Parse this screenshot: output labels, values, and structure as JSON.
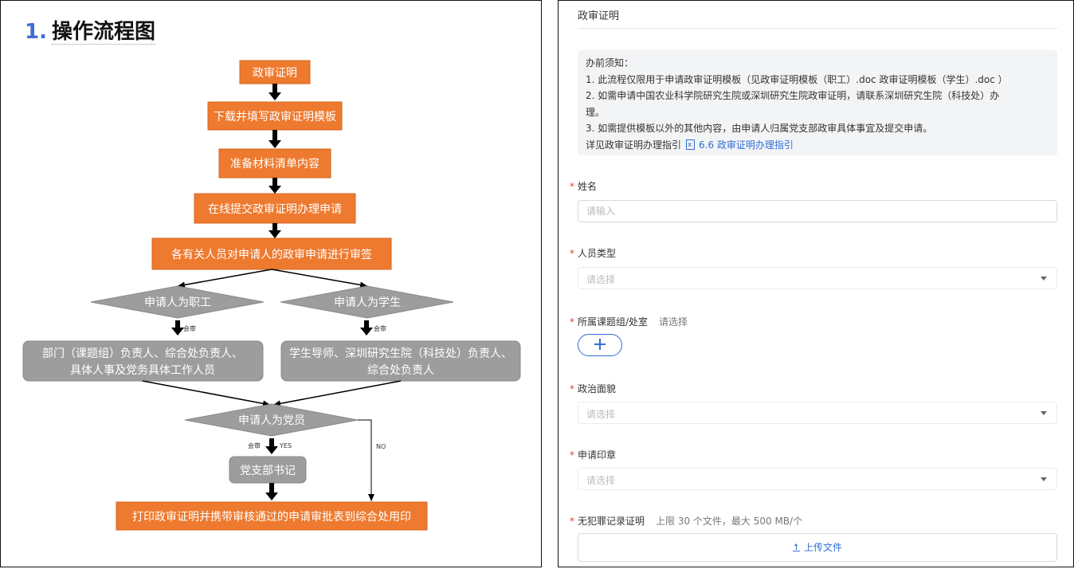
{
  "flowchart": {
    "title_number": "1.",
    "title": "操作流程图",
    "steps": {
      "s1": "政审证明",
      "s2": "下载并填写政审证明模板",
      "s3": "准备材料清单内容",
      "s4": "在线提交政审证明办理申请",
      "s5": "各有关人员对申请人的政审申请进行审签"
    },
    "decisions": {
      "staff": "申请人为职工",
      "student": "申请人为学生",
      "party": "申请人为党员"
    },
    "approvers": {
      "staff_line1": "部门（课题组）负责人、综合处负责人、",
      "staff_line2": "具体人事及党务具体工作人员",
      "student_line1": "学生导师、深圳研究生院（科技处）负责人、",
      "student_line2": "综合处负责人"
    },
    "party_secretary": "党支部书记",
    "final_step": "打印政审证明并携带审核通过的申请审批表到综合处用印",
    "labels": {
      "countersign": "会审",
      "yes": "YES",
      "no": "NO"
    }
  },
  "form": {
    "title": "政审证明",
    "notice": {
      "heading": "办前须知：",
      "line1": "1. 此流程仅限用于申请政审证明模板（见政审证明模板（职工）.doc 政审证明模板（学生）.doc ）",
      "line2a": "2. 如需申请中国农业科学院研究生院或深圳研究生院政审证明，请联系深圳研究生院（科技处）办",
      "line2b": "理。",
      "line3": "3. 如需提供模板以外的其他内容，由申请人归属党支部政审具体事宜及提交申请。",
      "guide_label": "详见政审证明办理指引",
      "guide_link": "6.6 政审证明办理指引"
    },
    "required_mark": "*",
    "fields": {
      "name": {
        "label": "姓名",
        "placeholder": "请输入"
      },
      "person_type": {
        "label": "人员类型",
        "placeholder": "请选择"
      },
      "group": {
        "label": "所属课题组/处室",
        "hint": "请选择"
      },
      "political_status": {
        "label": "政治面貌",
        "placeholder": "请选择"
      },
      "seal": {
        "label": "申请印章",
        "placeholder": "请选择"
      },
      "no_crime_record": {
        "label": "无犯罪记录证明",
        "hint": "上限 30 个文件，最大 500 MB/个",
        "upload_label": "上传文件"
      }
    }
  },
  "colors": {
    "flow_orange": "#ee7a2f",
    "flow_gray": "#9d9d9d",
    "link_blue": "#2f6fd6",
    "required_red": "#e53935"
  }
}
